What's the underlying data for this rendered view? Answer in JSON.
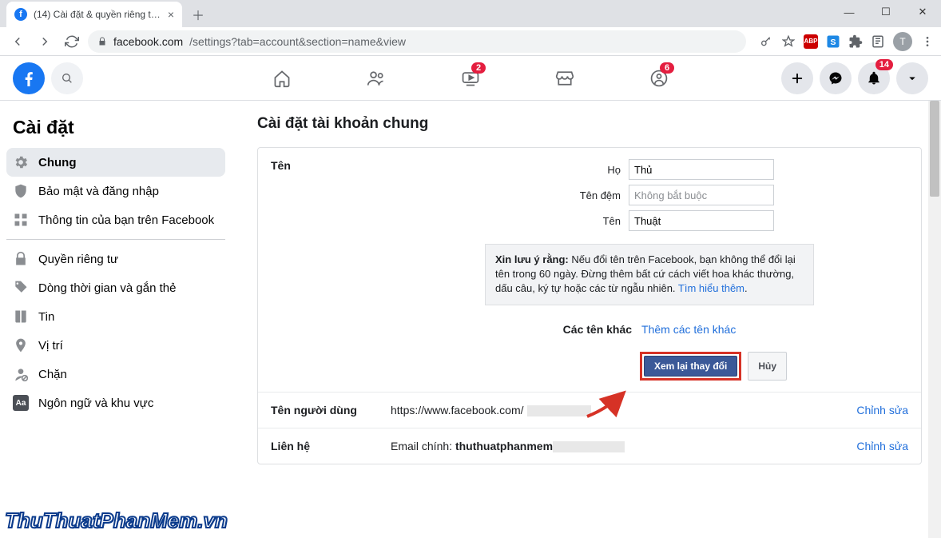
{
  "browser": {
    "tab_title": "(14) Cài đặt & quyền riêng tư | Fa",
    "url_host": "facebook.com",
    "url_path": "/settings?tab=account&section=name&view",
    "profile_letter": "T"
  },
  "fb_header": {
    "watch_badge": "2",
    "groups_badge": "6",
    "notif_badge": "14"
  },
  "sidebar": {
    "title": "Cài đặt",
    "items": {
      "general": "Chung",
      "security": "Bảo mật và đăng nhập",
      "yourinfo": "Thông tin của bạn trên Facebook",
      "privacy": "Quyền riêng tư",
      "timeline": "Dòng thời gian và gắn thẻ",
      "stories": "Tin",
      "location": "Vị trí",
      "blocking": "Chặn",
      "language": "Ngôn ngữ và khu vực"
    }
  },
  "main": {
    "heading": "Cài đặt tài khoản chung",
    "name": {
      "label": "Tên",
      "last_lbl": "Họ",
      "last_val": "Thủ",
      "middle_lbl": "Tên đệm",
      "middle_placeholder": "Không bắt buộc",
      "first_lbl": "Tên",
      "first_val": "Thuật",
      "notice_bold": "Xin lưu ý rằng:",
      "notice_text": " Nếu đổi tên trên Facebook, bạn không thể đổi lại tên trong 60 ngày. Đừng thêm bất cứ cách viết hoa khác thường, dấu câu, ký tự hoặc các từ ngẫu nhiên. ",
      "notice_learn": "Tìm hiểu thêm",
      "other_lbl": "Các tên khác",
      "other_link": "Thêm các tên khác",
      "review_btn": "Xem lại thay đổi",
      "cancel_btn": "Hủy"
    },
    "username": {
      "label": "Tên người dùng",
      "prefix": "https://www.facebook.com/",
      "edit": "Chỉnh sửa"
    },
    "contact": {
      "label": "Liên hệ",
      "text_prefix": "Email chính: ",
      "text_value": "thuthuatphanmem",
      "edit": "Chỉnh sửa"
    }
  },
  "watermark": "ThuThuatPhanMem.vn"
}
